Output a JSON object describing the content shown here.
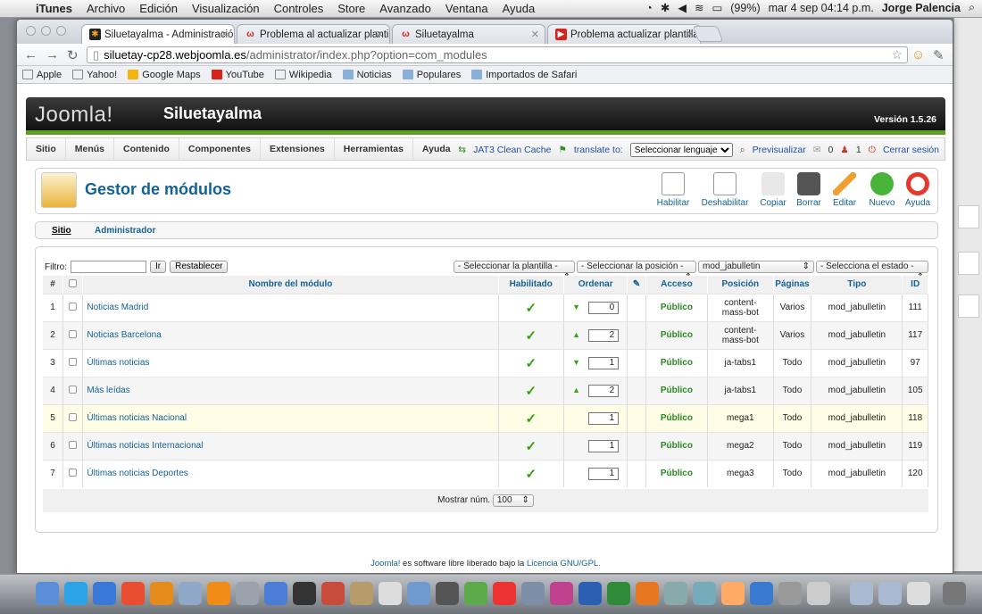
{
  "menubar": {
    "app": "iTunes",
    "items": [
      "Archivo",
      "Edición",
      "Visualización",
      "Controles",
      "Store",
      "Avanzado",
      "Ventana",
      "Ayuda"
    ],
    "battery": "(99%)",
    "datetime": "mar 4 sep  04:14 p.m.",
    "user": "Jorge Palencia"
  },
  "browser": {
    "tabs": [
      {
        "title": "Siluetayalma - Administració",
        "icon": "joomla-icon"
      },
      {
        "title": "Problema al actualizar planti",
        "icon": "webjoomla-icon"
      },
      {
        "title": "Siluetayalma",
        "icon": "webjoomla-icon"
      },
      {
        "title": "Problema actualizar plantilla",
        "icon": "youtube-icon"
      }
    ],
    "url_host": "siluetay-cp28.webjoomla.es",
    "url_path": "/administrator/index.php?option=com_modules",
    "bookmarks": [
      "Apple",
      "Yahoo!",
      "Google Maps",
      "YouTube",
      "Wikipedia",
      "Noticias",
      "Populares",
      "Importados de Safari"
    ]
  },
  "joomla": {
    "logo": "Joomla!",
    "site_name": "Siluetayalma",
    "version": "Versión 1.5.26",
    "menu": [
      "Sitio",
      "Menús",
      "Contenido",
      "Componentes",
      "Extensiones",
      "Herramientas",
      "Ayuda"
    ],
    "jat3": "JAT3 Clean Cache",
    "translate": "translate to:",
    "language_select": "Seleccionar lenguaje",
    "preview": "Previsualizar",
    "messages_count": "0",
    "users_count": "1",
    "logout": "Cerrar sesión",
    "page_title": "Gestor de módulos",
    "toolbar": [
      "Habilitar",
      "Deshabilitar",
      "Copiar",
      "Borrar",
      "Editar",
      "Nuevo",
      "Ayuda"
    ],
    "subnav": [
      "Sitio",
      "Administrador"
    ],
    "filter_label": "Filtro:",
    "filter_go": "Ir",
    "filter_reset": "Restablecer",
    "selects": [
      "- Seleccionar la plantilla -",
      "- Seleccionar la posición -",
      "mod_jabulletin",
      "- Selecciona el estado -"
    ],
    "columns": [
      "#",
      "",
      "Nombre del módulo",
      "Habilitado",
      "Ordenar",
      "",
      "Acceso",
      "Posición",
      "Páginas",
      "Tipo",
      "ID"
    ],
    "rows": [
      {
        "num": "1",
        "name": "Noticias Madrid",
        "order": "0",
        "arrow": "down",
        "access": "Público",
        "position": "content-mass-bot",
        "pages": "Varios",
        "type": "mod_jabulletin",
        "id": "111"
      },
      {
        "num": "2",
        "name": "Noticias Barcelona",
        "order": "2",
        "arrow": "up",
        "access": "Público",
        "position": "content-mass-bot",
        "pages": "Varios",
        "type": "mod_jabulletin",
        "id": "117"
      },
      {
        "num": "3",
        "name": "Últimas noticias",
        "order": "1",
        "arrow": "down",
        "access": "Público",
        "position": "ja-tabs1",
        "pages": "Todo",
        "type": "mod_jabulletin",
        "id": "97"
      },
      {
        "num": "4",
        "name": "Más leídas",
        "order": "2",
        "arrow": "up",
        "access": "Público",
        "position": "ja-tabs1",
        "pages": "Todo",
        "type": "mod_jabulletin",
        "id": "105"
      },
      {
        "num": "5",
        "name": "Últimas noticias Nacional",
        "order": "1",
        "arrow": "",
        "access": "Público",
        "position": "mega1",
        "pages": "Todo",
        "type": "mod_jabulletin",
        "id": "118"
      },
      {
        "num": "6",
        "name": "Últimas noticias Internacional",
        "order": "1",
        "arrow": "",
        "access": "Público",
        "position": "mega2",
        "pages": "Todo",
        "type": "mod_jabulletin",
        "id": "119"
      },
      {
        "num": "7",
        "name": "Últimas noticias Deportes",
        "order": "1",
        "arrow": "",
        "access": "Público",
        "position": "mega3",
        "pages": "Todo",
        "type": "mod_jabulletin",
        "id": "120"
      }
    ],
    "pager_label": "Mostrar núm.",
    "pager_value": "100",
    "footer_link1": "Joomla!",
    "footer_text": "es software libre liberado bajo la",
    "footer_link2": "Licencia GNU/GPL."
  }
}
